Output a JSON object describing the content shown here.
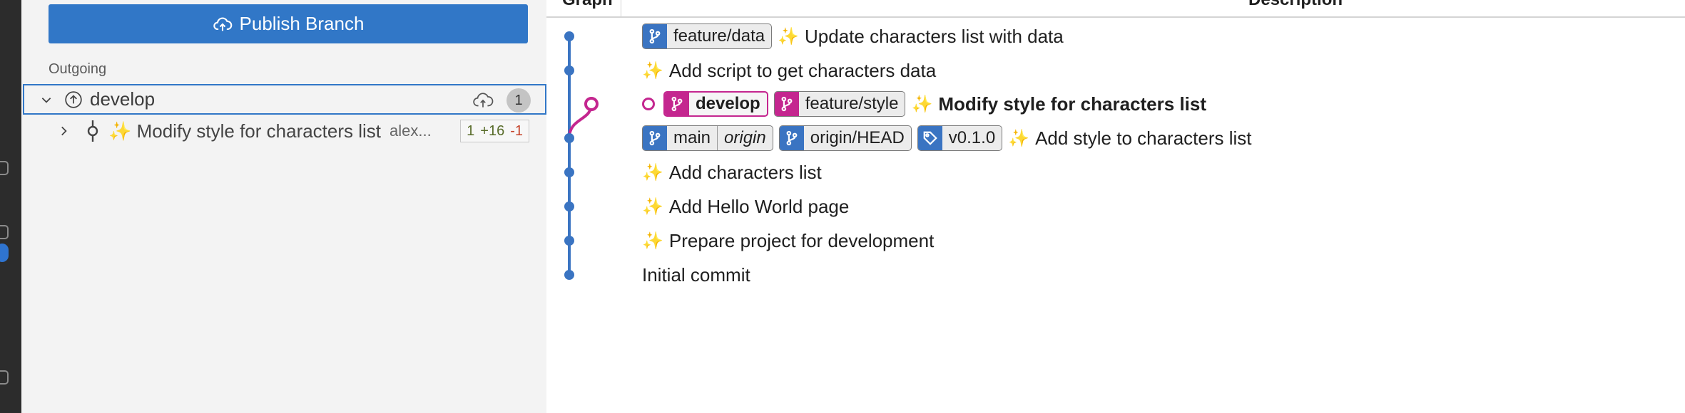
{
  "sidebar": {
    "publish_label": "Publish Branch",
    "section_label": "Outgoing",
    "branch": {
      "name": "develop",
      "count": "1"
    },
    "commit": {
      "message": "✨ Modify style for characters list",
      "author": "alex...",
      "files": "1",
      "additions": "+16",
      "deletions": "-1"
    }
  },
  "graph": {
    "header_graph": "Graph",
    "header_description": "Description",
    "rows": [
      {
        "refs": [
          {
            "name": "feature/data"
          }
        ],
        "message": "Update characters list with data"
      },
      {
        "message": "Add script to get characters data"
      },
      {
        "refs": [
          {
            "name": "develop"
          },
          {
            "name": "feature/style"
          }
        ],
        "message": "Modify style for characters list"
      },
      {
        "refs": [
          {
            "name": "main",
            "remote": "origin"
          },
          {
            "name": "origin/HEAD"
          },
          {
            "name": "v0.1.0"
          }
        ],
        "message": "Add style to characters list"
      },
      {
        "message": "Add characters list"
      },
      {
        "message": "Add Hello World page"
      },
      {
        "message": "Prepare project for development"
      },
      {
        "message": "Initial commit"
      }
    ]
  },
  "colors": {
    "accent": "#3177c7",
    "branch_blue": "#3a74c2",
    "branch_pink": "#c4268f"
  }
}
